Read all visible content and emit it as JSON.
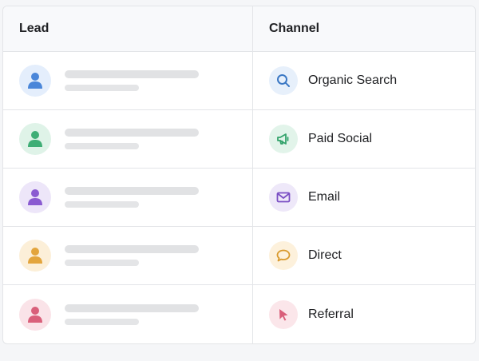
{
  "table": {
    "headers": {
      "lead": "Lead",
      "channel": "Channel"
    },
    "rows": [
      {
        "avatar_icon": "person-icon",
        "avatar_color": "#4a86d9",
        "avatar_bg": "#e4eefc",
        "channel": "Organic Search",
        "channel_icon": "search-icon",
        "channel_color": "#3b78c4",
        "channel_bg": "#e7f0fb"
      },
      {
        "avatar_icon": "person-icon",
        "avatar_color": "#3fae76",
        "avatar_bg": "#dff3e8",
        "channel": "Paid Social",
        "channel_icon": "megaphone-icon",
        "channel_color": "#33a36b",
        "channel_bg": "#e2f4ea"
      },
      {
        "avatar_icon": "person-icon",
        "avatar_color": "#8a5bd1",
        "avatar_bg": "#ede6f9",
        "channel": "Email",
        "channel_icon": "mail-icon",
        "channel_color": "#7b4fc4",
        "channel_bg": "#eee8f9"
      },
      {
        "avatar_icon": "person-icon",
        "avatar_color": "#e3a53d",
        "avatar_bg": "#fcefd8",
        "channel": "Direct",
        "channel_icon": "chat-icon",
        "channel_color": "#d99a2e",
        "channel_bg": "#fdf1dc"
      },
      {
        "avatar_icon": "person-icon",
        "avatar_color": "#d9607a",
        "avatar_bg": "#fae3e8",
        "channel": "Referral",
        "channel_icon": "cursor-icon",
        "channel_color": "#d95f7a",
        "channel_bg": "#fbe6ea"
      }
    ]
  }
}
